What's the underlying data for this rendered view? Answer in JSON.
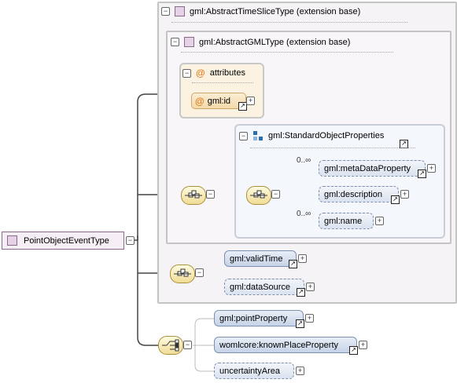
{
  "root": {
    "label": "PointObjectEventType"
  },
  "abstract_time_slice": {
    "label": "gml:AbstractTimeSliceType (extension base)"
  },
  "abstract_gml": {
    "label": "gml:AbstractGMLType (extension base)"
  },
  "attributes": {
    "header": "attributes",
    "items": [
      {
        "label": "gml:id"
      }
    ]
  },
  "standard_props": {
    "label": "gml:StandardObjectProperties",
    "elements": [
      {
        "label": "gml:metaDataProperty",
        "cardinality": "0..∞"
      },
      {
        "label": "gml:description",
        "cardinality": ""
      },
      {
        "label": "gml:name",
        "cardinality": "0..∞"
      }
    ]
  },
  "time_slice_seq": [
    {
      "label": "gml:validTime"
    },
    {
      "label": "gml:dataSource"
    }
  ],
  "choice_elements": [
    {
      "label": "gml:pointProperty"
    },
    {
      "label": "womlcore:knownPlaceProperty"
    },
    {
      "label": "uncertaintyArea"
    }
  ],
  "icons": {
    "collapse": "minus-toggle-icon",
    "expand": "plus-toggle-icon",
    "reference": "reference-arrow-icon",
    "sequence": "sequence-compositor-icon",
    "choice": "choice-compositor-icon",
    "group": "group-icon",
    "type": "complex-type-icon",
    "attribute": "attribute-at-icon"
  },
  "colors": {
    "element_fill": "#c6d3e7",
    "attribute_fill": "#f3d9a8",
    "compositor_fill": "#f0dc96",
    "type_fill": "#e6d2e6",
    "extension_bg": "#f6f3f6"
  }
}
